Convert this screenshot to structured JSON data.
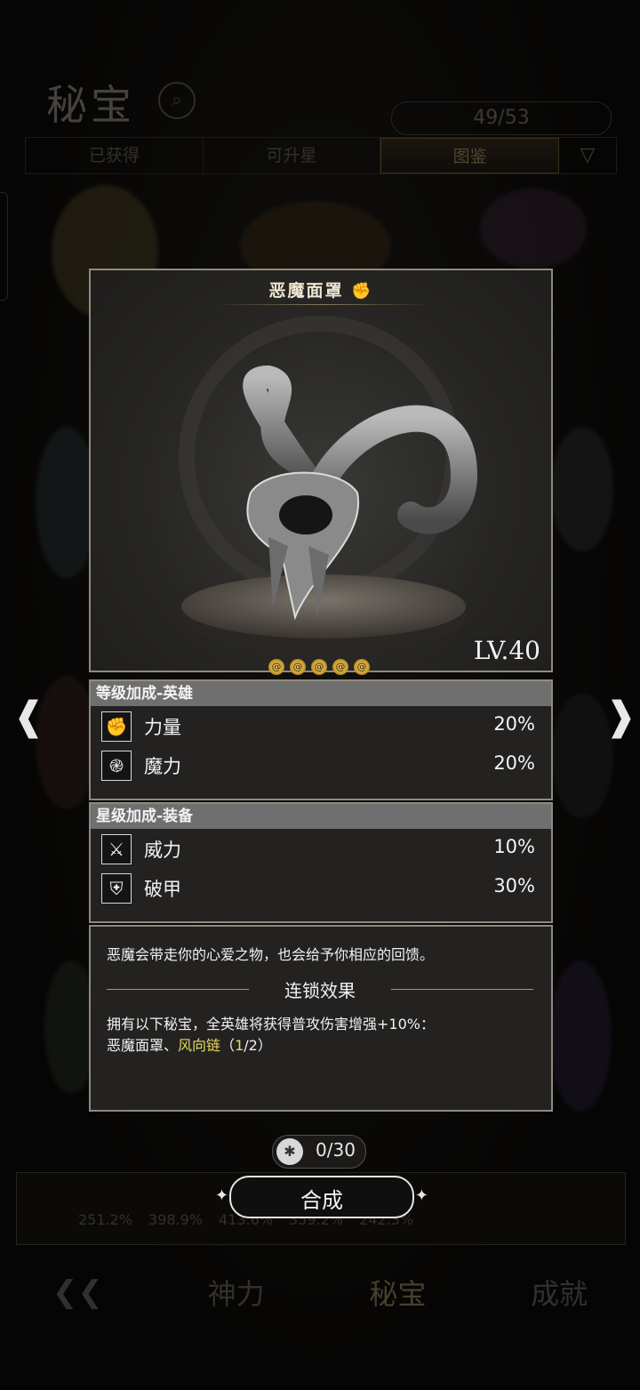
{
  "background": {
    "page_title": "秘宝",
    "counter": "49/53",
    "tabs": [
      {
        "label": "已获得",
        "active": false
      },
      {
        "label": "可升星",
        "active": false
      },
      {
        "label": "图鉴",
        "active": true
      }
    ],
    "bottom_stats": [
      "251.2%",
      "398.9%",
      "413.6%",
      "359.2%",
      "242.3%"
    ],
    "bottom_nav": [
      {
        "label": "神力",
        "active": false
      },
      {
        "label": "秘宝",
        "active": true
      },
      {
        "label": "成就",
        "active": false
      }
    ]
  },
  "popup": {
    "item_name": "恶魔面罩",
    "level": "LV.40",
    "stars": 5,
    "level_bonus": {
      "title": "等级加成-英雄",
      "stats": [
        {
          "name": "力量",
          "value": "20%",
          "icon": "fist-icon"
        },
        {
          "name": "魔力",
          "value": "20%",
          "icon": "swirl-icon"
        }
      ]
    },
    "star_bonus": {
      "title": "星级加成-装备",
      "stats": [
        {
          "name": "威力",
          "value": "10%",
          "icon": "crossed-swords-icon"
        },
        {
          "name": "破甲",
          "value": "30%",
          "icon": "broken-shield-icon"
        }
      ]
    },
    "description": "恶魔会带走你的心爱之物，也会给予你相应的回馈。",
    "chain_title": "连锁效果",
    "chain_text_line1": "拥有以下秘宝，全英雄将获得普攻伤害增强+10%：",
    "chain_items": {
      "item1": "恶魔面罩",
      "sep": "、",
      "item2": "风向链",
      "open": "（",
      "have": "1",
      "total": "/2",
      "close": "）"
    },
    "fragment_progress": "0/30",
    "synth_button": "合成"
  },
  "colors": {
    "highlight": "#e7d962",
    "panel_border": "#8f8a80",
    "header_gray": "#6f6f6f"
  }
}
